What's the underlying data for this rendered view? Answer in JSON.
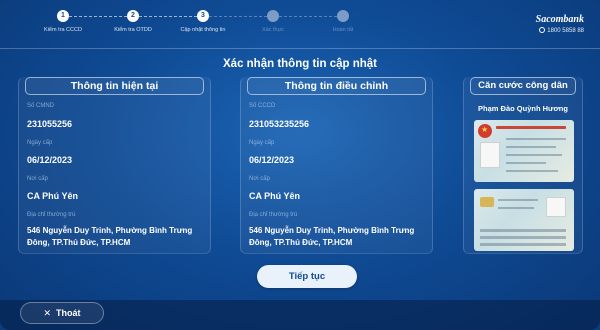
{
  "stepper": {
    "steps": [
      {
        "num": "1",
        "label": "Kiểm tra CCCD",
        "active": true
      },
      {
        "num": "2",
        "label": "Kiểm tra OTDD",
        "active": true
      },
      {
        "num": "3",
        "label": "Cập nhật thông tin",
        "active": true
      },
      {
        "num": "4",
        "label": "Xác thực",
        "active": false
      },
      {
        "num": "5",
        "label": "Hoàn tất",
        "active": false
      }
    ]
  },
  "brand": {
    "name": "Sacombank",
    "hotline": "1800 5858 88"
  },
  "page_title": "Xác nhận thông tin cập nhật",
  "current": {
    "title": "Thông tin hiện tại",
    "id_label": "Số CMND",
    "id_value": "231055256",
    "date_label": "Ngày cấp",
    "date_value": "06/12/2023",
    "place_label": "Nơi cấp",
    "place_value": "CA Phú Yên",
    "address_label": "Địa chỉ thường trú",
    "address_value": "546 Nguyễn Duy Trinh, Phường Bình Trưng Đông, TP.Thủ Đức, TP.HCM"
  },
  "updated": {
    "title": "Thông tin điều chỉnh",
    "id_label": "Số CCCD",
    "id_value": "231053235256",
    "date_label": "Ngày cấp",
    "date_value": "06/12/2023",
    "place_label": "Nơi cấp",
    "place_value": "CA Phú Yên",
    "address_label": "Địa chỉ thường trú",
    "address_value": "546 Nguyễn Duy Trinh, Phường Bình Trưng Đông, TP.Thủ Đức, TP.HCM"
  },
  "card": {
    "title": "Căn cước công dân",
    "owner": "Phạm Đào Quỳnh Hương"
  },
  "actions": {
    "continue_label": "Tiếp tục",
    "exit_label": "Thoát"
  },
  "icons": {
    "exit": "close-icon",
    "hotline": "phone-icon",
    "emblem": "national-emblem-icon"
  },
  "colors": {
    "background": "#0f4b95",
    "button_bg": "#e9f1fb",
    "button_text": "#0f4b95"
  }
}
